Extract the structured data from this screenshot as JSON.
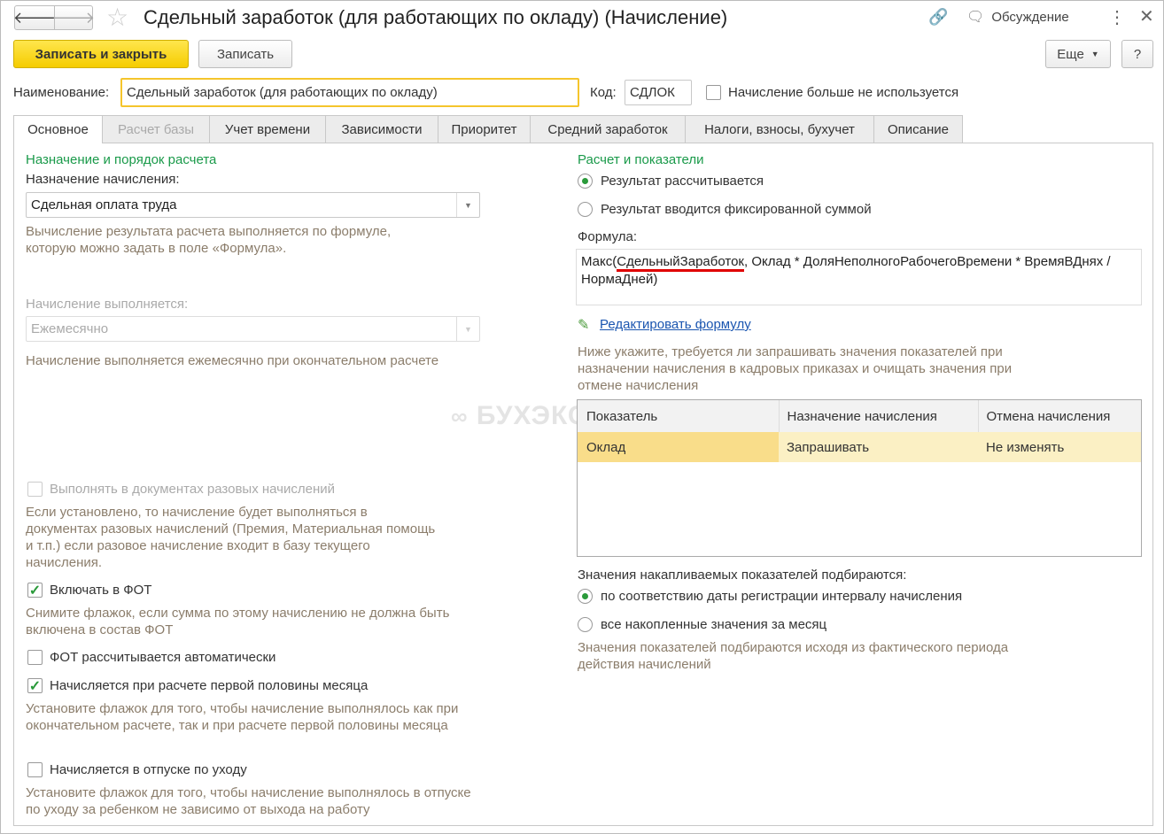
{
  "window": {
    "title": "Сдельный заработок (для работающих по окладу) (Начисление)",
    "discussion": "Обсуждение"
  },
  "toolbar": {
    "save_close": "Записать и закрыть",
    "save": "Записать",
    "more": "Еще",
    "help": "?"
  },
  "header": {
    "name_label": "Наименование:",
    "name_value": "Сдельный заработок (для работающих по окладу)",
    "code_label": "Код:",
    "code_value": "СДЛОК",
    "unused_label": "Начисление больше не используется"
  },
  "tabs": [
    "Основное",
    "Расчет базы",
    "Учет времени",
    "Зависимости",
    "Приоритет",
    "Средний заработок",
    "Налоги, взносы, бухучет",
    "Описание"
  ],
  "left": {
    "section": "Назначение и порядок расчета",
    "purpose_label": "Назначение начисления:",
    "purpose_value": "Сдельная оплата труда",
    "purpose_hint": "Вычисление результата расчета выполняется по формуле, которую можно задать в поле «Формула».",
    "exec_label": "Начисление выполняется:",
    "exec_value": "Ежемесячно",
    "exec_hint": "Начисление выполняется ежемесячно при окончательном расчете",
    "one_time_label": "Выполнять в документах разовых начислений",
    "one_time_hint": "Если установлено, то начисление будет выполняться в документах разовых начислений (Премия, Материальная помощь и т.п.) если разовое начисление входит в базу текущего начисления.",
    "fot_label": "Включать в ФОТ",
    "fot_hint": "Снимите флажок, если сумма по этому начислению не должна быть включена в состав ФОТ",
    "fot_auto_label": "ФОТ рассчитывается автоматически",
    "half_label": "Начисляется при расчете первой половины месяца",
    "half_hint": "Установите флажок для того, чтобы начисление выполнялось как при окончательном расчете, так и при расчете первой половины месяца",
    "leave_label": "Начисляется в отпуске по уходу",
    "leave_hint": "Установите флажок для того, чтобы начисление выполнялось в отпуске по уходу за ребенком не зависимо от выхода на работу"
  },
  "right": {
    "section": "Расчет и показатели",
    "radio_calc": "Результат рассчитывается",
    "radio_fixed": "Результат вводится фиксированной суммой",
    "formula_label": "Формула:",
    "formula_prefix": "Макс(",
    "formula_highlight": "СдельныйЗаработок",
    "formula_rest": ", Оклад * ДоляНеполногоРабочегоВремени * ВремяВДнях / НормаДней)",
    "edit_link": "Редактировать формулу",
    "table_hint": "Ниже укажите, требуется ли запрашивать значения показателей при назначении начисления в кадровых приказах и очищать значения при отмене начисления",
    "table": {
      "headers": [
        "Показатель",
        "Назначение начисления",
        "Отмена начисления"
      ],
      "rows": [
        [
          "Оклад",
          "Запрашивать",
          "Не изменять"
        ]
      ]
    },
    "accum_label": "Значения накапливаемых показателей подбираются:",
    "accum_opt1": "по соответствию даты регистрации интервалу начисления",
    "accum_opt2": "все накопленные значения за месяц",
    "accum_hint": "Значения показателей подбираются исходя из фактического периода действия начислений"
  },
  "watermark": "БУХЭКСПЕРТ"
}
